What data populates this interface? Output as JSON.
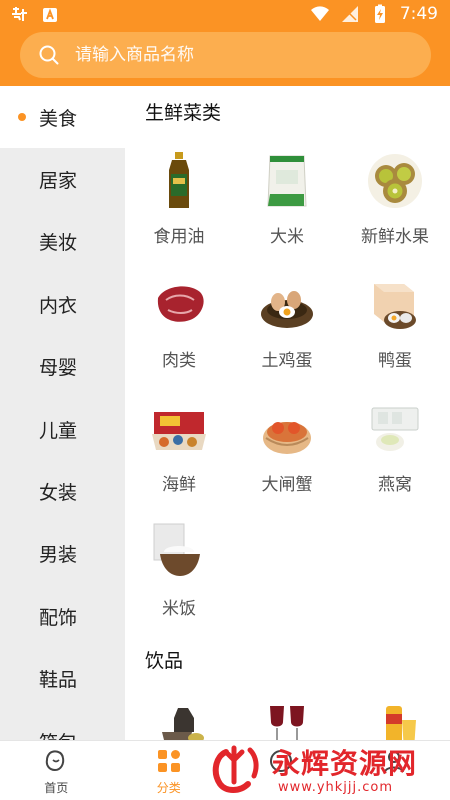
{
  "status_bar": {
    "time": "7:49"
  },
  "search": {
    "placeholder": "请输入商品名称"
  },
  "sidebar": {
    "items": [
      {
        "label": "美食",
        "active": true
      },
      {
        "label": "居家"
      },
      {
        "label": "美妆"
      },
      {
        "label": "内衣"
      },
      {
        "label": "母婴"
      },
      {
        "label": "儿童"
      },
      {
        "label": "女装"
      },
      {
        "label": "男装"
      },
      {
        "label": "配饰"
      },
      {
        "label": "鞋品"
      },
      {
        "label": "箱包"
      }
    ]
  },
  "sections": [
    {
      "title": "生鲜菜类",
      "items": [
        {
          "label": "食用油",
          "icon": "oil-bottle-icon"
        },
        {
          "label": "大米",
          "icon": "rice-bag-icon"
        },
        {
          "label": "新鲜水果",
          "icon": "kiwi-fruit-icon"
        },
        {
          "label": "肉类",
          "icon": "meat-icon"
        },
        {
          "label": "土鸡蛋",
          "icon": "eggs-nest-icon"
        },
        {
          "label": "鸭蛋",
          "icon": "duck-egg-box-icon"
        },
        {
          "label": "海鲜",
          "icon": "seafood-box-icon"
        },
        {
          "label": "大闸蟹",
          "icon": "crab-steamer-icon"
        },
        {
          "label": "燕窝",
          "icon": "birds-nest-icon"
        },
        {
          "label": "米饭",
          "icon": "rice-bowl-icon"
        }
      ]
    },
    {
      "title": "饮品",
      "items": [
        {
          "label": "",
          "icon": "tea-set-icon"
        },
        {
          "label": "",
          "icon": "wine-glasses-icon"
        },
        {
          "label": "",
          "icon": "juice-drink-icon"
        }
      ]
    }
  ],
  "tab_bar": {
    "tabs": [
      {
        "label": "首页",
        "icon": "home-icon"
      },
      {
        "label": "分类",
        "icon": "category-grid-icon",
        "active": true
      },
      {
        "label": "",
        "icon": "explore-icon"
      },
      {
        "label": "",
        "icon": "profile-icon"
      }
    ]
  },
  "watermark": {
    "text": "永辉资源网",
    "url": "www.yhkjjj.com"
  },
  "colors": {
    "accent": "#fb9324",
    "search_bg": "#fcae4f",
    "sidebar_bg": "#ededed",
    "watermark": "#e2262b"
  }
}
